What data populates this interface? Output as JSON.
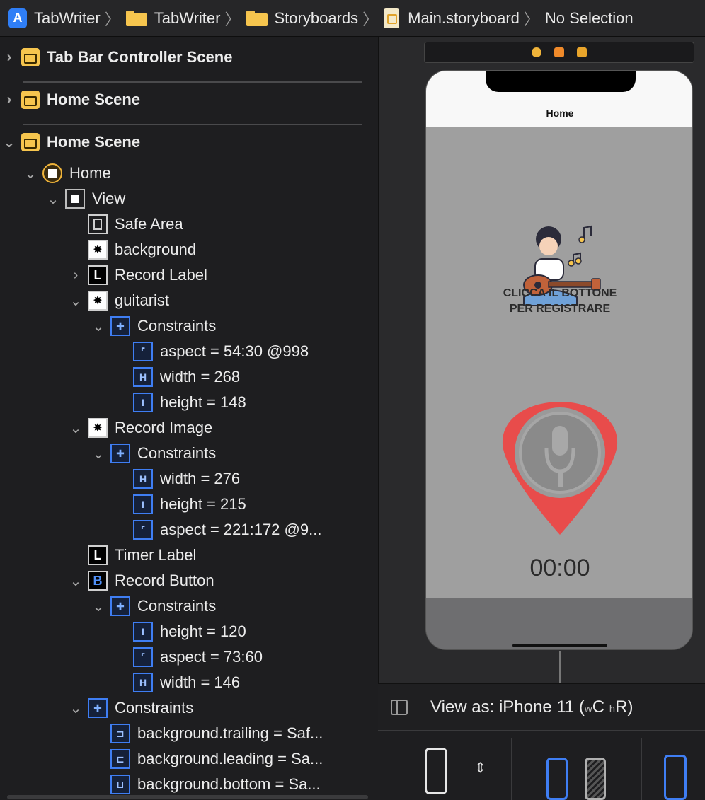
{
  "breadcrumb": {
    "items": [
      "TabWriter",
      "TabWriter",
      "Storyboards",
      "Main.storyboard",
      "No Selection"
    ]
  },
  "outline": {
    "scenes": [
      "Tab Bar Controller Scene",
      "Home Scene",
      "Home Scene"
    ],
    "tree": {
      "home": "Home",
      "view": "View",
      "safe_area": "Safe Area",
      "background": "background",
      "record_label": "Record Label",
      "guitarist": "guitarist",
      "guitarist_constraints": "Constraints",
      "guitarist_c1": "aspect = 54:30 @998",
      "guitarist_c2": "width = 268",
      "guitarist_c3": "height = 148",
      "record_image": "Record Image",
      "record_image_constraints": "Constraints",
      "record_image_c1": "width = 276",
      "record_image_c2": "height = 215",
      "record_image_c3": "aspect = 221:172 @9...",
      "timer_label": "Timer Label",
      "record_button": "Record Button",
      "record_button_constraints": "Constraints",
      "record_button_c1": "height = 120",
      "record_button_c2": "aspect = 73:60",
      "record_button_c3": "width = 146",
      "view_constraints": "Constraints",
      "view_c1": "background.trailing = Saf...",
      "view_c2": "background.leading = Sa...",
      "view_c3": "background.bottom = Sa..."
    }
  },
  "canvas": {
    "nav_title": "Home",
    "record_text_line1": "CLICCA IL BOTTONE",
    "record_text_line2": "PER REGISTRARE",
    "timer": "00:00"
  },
  "bottom": {
    "view_as_prefix": "View as: iPhone 11 (",
    "size_w": "w",
    "size_c": "C",
    "size_h": "h",
    "size_r": "R)"
  },
  "colors": {
    "accent": "#3f7ef3",
    "scene_icon": "#f6c54e",
    "pick_red": "#e84c4b"
  }
}
